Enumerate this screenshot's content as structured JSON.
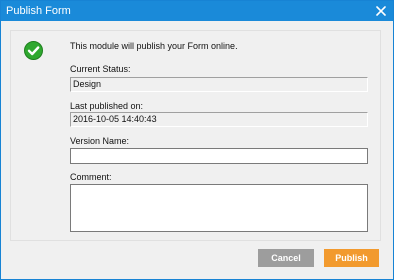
{
  "window": {
    "title": "Publish Form",
    "close_icon": "close-icon"
  },
  "message": {
    "icon": "success-check-icon",
    "text": "This module will publish your Form online."
  },
  "current_status": {
    "label": "Current Status:",
    "value": "Design"
  },
  "last_published": {
    "label": "Last published on:",
    "value": "2016-10-05 14:40:43"
  },
  "version_name": {
    "label": "Version Name:",
    "value": ""
  },
  "comment": {
    "label": "Comment:",
    "value": ""
  },
  "buttons": {
    "cancel": "Cancel",
    "publish": "Publish"
  },
  "colors": {
    "titlebar": "#1a8ad9",
    "publish_button": "#f29a2e",
    "cancel_button": "#9d9d9d",
    "success_icon": "#2fa82f"
  }
}
